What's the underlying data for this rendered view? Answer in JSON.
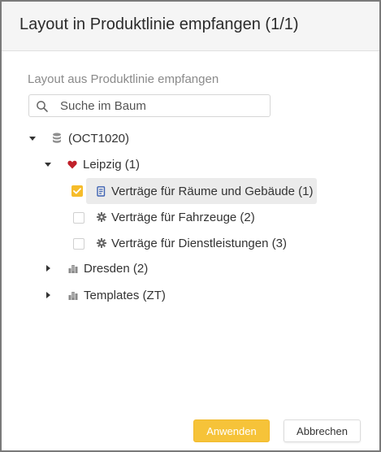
{
  "dialog": {
    "title": "Layout in Produktlinie empfangen (1/1)",
    "subtitle": "Layout aus Produktlinie empfangen"
  },
  "search": {
    "placeholder": "Suche im Baum",
    "value": ""
  },
  "tree": {
    "root": {
      "label": "(OCT1020)",
      "icon": "database-icon",
      "expanded": true
    },
    "leipzig": {
      "label": "Leipzig (1)",
      "icon": "heart-icon",
      "expanded": true
    },
    "items": [
      {
        "label": "Verträge für Räume und Gebäude (1)",
        "icon": "document-icon",
        "checked": true,
        "selected": true
      },
      {
        "label": "Verträge für Fahrzeuge (2)",
        "icon": "gear-icon",
        "checked": false,
        "selected": false
      },
      {
        "label": "Verträge für Dienstleistungen (3)",
        "icon": "gear-icon",
        "checked": false,
        "selected": false
      }
    ],
    "dresden": {
      "label": "Dresden (2)",
      "icon": "building-icon",
      "expanded": false
    },
    "templates": {
      "label": "Templates (ZT)",
      "icon": "building-icon",
      "expanded": false
    }
  },
  "buttons": {
    "apply": "Anwenden",
    "cancel": "Abbrechen"
  },
  "colors": {
    "accent": "#f6bc2a",
    "heart": "#c0202a",
    "document_icon": "#3f63b3",
    "selected_row": "#ebebeb",
    "header_bg": "#f5f5f5"
  }
}
